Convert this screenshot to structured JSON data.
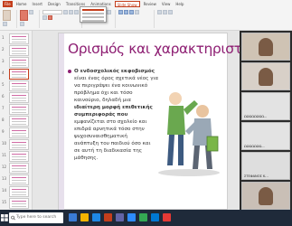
{
  "app": {
    "ribbon_tabs": [
      "File",
      "Home",
      "Insert",
      "Design",
      "Transitions",
      "Animations",
      "Slide Show",
      "Review",
      "View",
      "Help"
    ],
    "active_tab_index": 6,
    "accent_color": "#c43e1c"
  },
  "thumbnails": {
    "numbers": [
      "1",
      "2",
      "3",
      "4",
      "5",
      "6",
      "7",
      "8",
      "9",
      "10",
      "11",
      "12",
      "13",
      "14",
      "15"
    ],
    "active_index": 3
  },
  "slide": {
    "title": "Ορισμός και χαρακτηριστικά",
    "title_color": "#8e1f73",
    "bullet_lines": [
      {
        "text": "Ο ενδοσχολικός εκφοβισμός",
        "bold": true
      },
      {
        "text": "είναι ένας όρος σχετικά νέος για",
        "bold": false
      },
      {
        "text": "να περιγράψει ένα κοινωνικό",
        "bold": false
      },
      {
        "text": "πρόβλημα όχι και τόσο",
        "bold": false
      },
      {
        "text": "καινούριο, δηλαδή μια",
        "bold": false
      },
      {
        "text": "ιδιαίτερη μορφή επιθετικής",
        "bold": true
      },
      {
        "text": "συμπεριφοράς που",
        "bold": true
      },
      {
        "text": "εμφανίζεται στο σχολείο και",
        "bold": false
      },
      {
        "text": "επιδρά αρνητικά τόσο στην",
        "bold": false
      },
      {
        "text": "ψυχοσυναισθηματική",
        "bold": false
      },
      {
        "text": "ανάπτυξη του παιδιού όσο και",
        "bold": false
      },
      {
        "text": "σε αυτή τη διαδικασία της",
        "bold": false
      },
      {
        "text": "μάθησης.",
        "bold": false
      }
    ],
    "figure_icon": "bullying-illustration-icon"
  },
  "participants": [
    {
      "label": ""
    },
    {
      "label": ""
    },
    {
      "label": "ΩΩΩΩΩΩΩΩ..."
    },
    {
      "label": "ΩΩΩΩΩΩΩ..."
    },
    {
      "label": "ΣΤΕΦΑΝΟΣ Κ..."
    },
    {
      "label": ""
    }
  ],
  "taskbar": {
    "search_placeholder": "Type here to search",
    "clock_time": "",
    "clock_date": ""
  }
}
